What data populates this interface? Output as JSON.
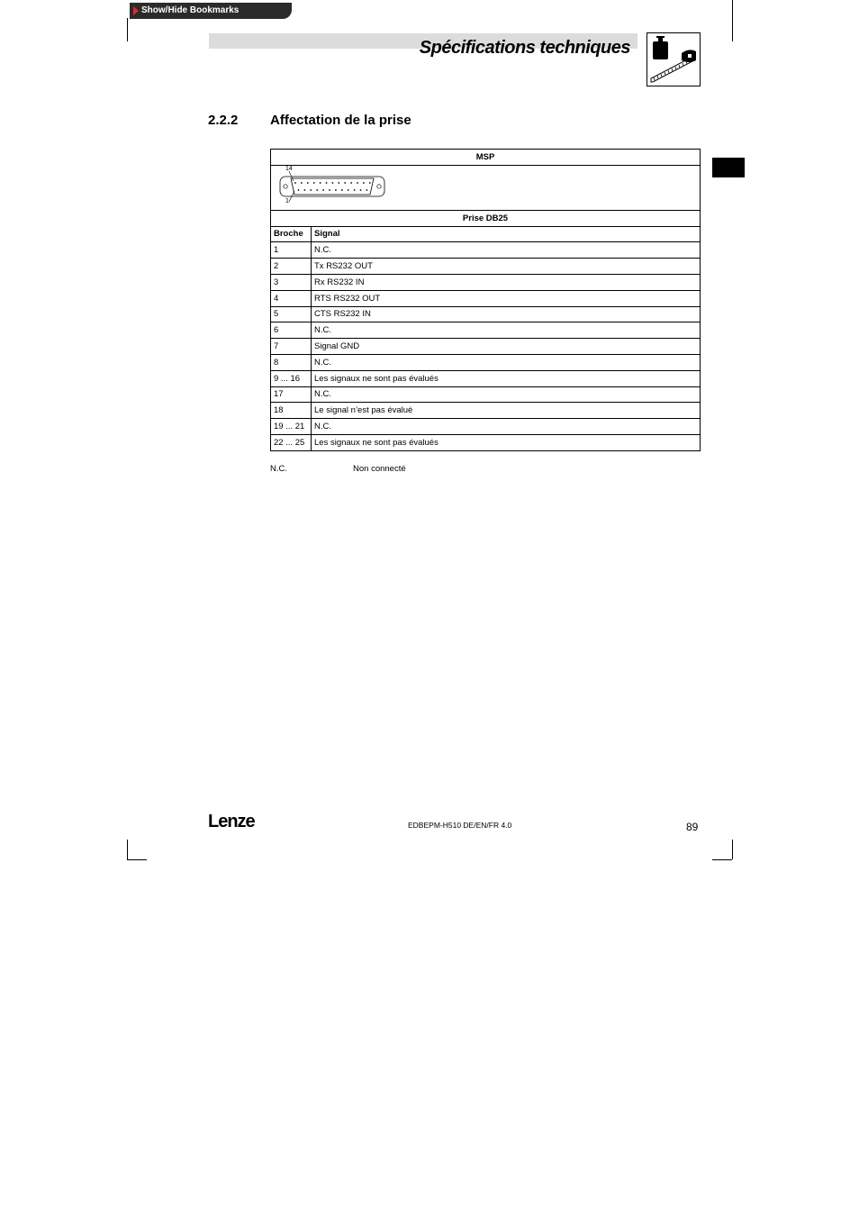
{
  "bookmarks_tab": {
    "label": "Show/Hide Bookmarks"
  },
  "header": {
    "title": "Spécifications techniques"
  },
  "section": {
    "number": "2.2.2",
    "title": "Affectation de la prise"
  },
  "table": {
    "title": "MSP",
    "connector": {
      "pin_top": "14",
      "pin_bottom": "1"
    },
    "connector_label": "Prise DB25",
    "columns": [
      "Broche",
      "Signal"
    ],
    "rows": [
      {
        "pin": "1",
        "signal": "N.C."
      },
      {
        "pin": "2",
        "signal": "Tx RS232 OUT"
      },
      {
        "pin": "3",
        "signal": "Rx RS232 IN"
      },
      {
        "pin": "4",
        "signal": "RTS RS232 OUT"
      },
      {
        "pin": "5",
        "signal": "CTS RS232 IN"
      },
      {
        "pin": "6",
        "signal": "N.C."
      },
      {
        "pin": "7",
        "signal": "Signal GND"
      },
      {
        "pin": "8",
        "signal": "N.C."
      },
      {
        "pin": "9 ... 16",
        "signal": "Les signaux ne sont pas évalués"
      },
      {
        "pin": "17",
        "signal": "N.C."
      },
      {
        "pin": "18",
        "signal": "Le signal n’est pas évalué"
      },
      {
        "pin": "19 ... 21",
        "signal": "N.C."
      },
      {
        "pin": "22 ... 25",
        "signal": "Les signaux ne sont pas évalués"
      }
    ]
  },
  "footnote": {
    "abbr": "N.C.",
    "text": "Non connecté"
  },
  "footer": {
    "logo": "Lenze",
    "doc_id": "EDBEPM-H510 DE/EN/FR 4.0",
    "page": "89"
  },
  "icons": {
    "bookmark_arrow": "triangle-right-icon",
    "header_icon": "weight-scale-icon",
    "connector": "db25-connector-icon"
  },
  "colors": {
    "bookmark_bg": "#2b2b2b",
    "bookmark_arrow": "#e0282d",
    "header_band": "#dcdcdc"
  }
}
